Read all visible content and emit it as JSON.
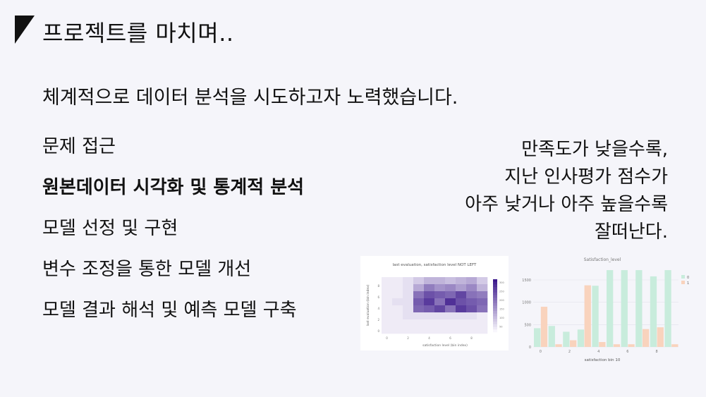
{
  "header": {
    "title": "프로젝트를 마치며.."
  },
  "subtitle": "체계적으로 데이터 분석을 시도하고자 노력했습니다.",
  "steps": [
    {
      "label": "문제 접근",
      "active": false
    },
    {
      "label": "원본데이터 시각화 및 통계적 분석",
      "active": true
    },
    {
      "label": "모델 선정 및 구현",
      "active": false
    },
    {
      "label": "변수 조정을 통한 모델 개선",
      "active": false
    },
    {
      "label": "모델 결과 해석 및 예측 모델 구축",
      "active": false
    }
  ],
  "finding": {
    "lines": [
      "만족도가 낮을수록,",
      "지난 인사평가 점수가",
      "아주 낮거나 아주 높을수록",
      "잘떠난다."
    ]
  },
  "colors": {
    "heat": "#3d1a8c",
    "green": "#c8ecdc",
    "peach": "#f9d3bd"
  },
  "chart_data": [
    {
      "type": "heatmap",
      "title": "last evaluation, satisfaction level NOT LEFT",
      "xlabel": "satisfaction level (bin index)",
      "ylabel": "last evaluation (bin index)",
      "x_ticks": [
        "0",
        "2",
        "4",
        "6",
        "8"
      ],
      "y_ticks": [
        "0",
        "2",
        "4",
        "6",
        "8"
      ],
      "colorbar_ticks": [
        "300",
        "250",
        "200",
        "150",
        "100",
        "50"
      ],
      "grid": [
        [
          0.05,
          0.05,
          0.1,
          0.2,
          0.3,
          0.3,
          0.25,
          0.3,
          0.35,
          0.2
        ],
        [
          0.05,
          0.05,
          0.1,
          0.35,
          0.55,
          0.45,
          0.5,
          0.4,
          0.5,
          0.3
        ],
        [
          0.05,
          0.05,
          0.1,
          0.6,
          0.75,
          0.7,
          0.65,
          0.8,
          0.6,
          0.55
        ],
        [
          0.05,
          0.1,
          0.1,
          0.7,
          0.85,
          0.6,
          0.9,
          0.75,
          0.7,
          0.65
        ],
        [
          0.05,
          0.05,
          0.1,
          0.65,
          0.7,
          0.8,
          0.6,
          0.85,
          0.75,
          0.6
        ],
        [
          0.05,
          0.05,
          0.1,
          0.1,
          0.1,
          0.1,
          0.1,
          0.1,
          0.1,
          0.05
        ],
        [
          0.05,
          0.05,
          0.05,
          0.05,
          0.05,
          0.05,
          0.05,
          0.05,
          0.05,
          0.05
        ],
        [
          0.05,
          0.05,
          0.05,
          0.05,
          0.05,
          0.05,
          0.05,
          0.05,
          0.05,
          0.05
        ]
      ]
    },
    {
      "type": "bar",
      "title": "Satisfaction_level",
      "xlabel": "satisfaction bin 10",
      "ylabel": "",
      "ylim": [
        0,
        1800
      ],
      "y_ticks": [
        0,
        500,
        1000,
        1500
      ],
      "x_ticks": [
        "0",
        "2",
        "4",
        "6",
        "8"
      ],
      "categories": [
        "0",
        "1",
        "2",
        "3",
        "4",
        "5",
        "6",
        "7",
        "8",
        "9"
      ],
      "series": [
        {
          "name": "0",
          "color": "#c8ecdc",
          "values": [
            420,
            470,
            340,
            390,
            1370,
            1720,
            1720,
            1720,
            1580,
            1720
          ]
        },
        {
          "name": "1",
          "color": "#f9d3bd",
          "values": [
            900,
            60,
            150,
            1380,
            110,
            60,
            60,
            400,
            440,
            60
          ]
        }
      ],
      "legend": "top-right"
    }
  ]
}
